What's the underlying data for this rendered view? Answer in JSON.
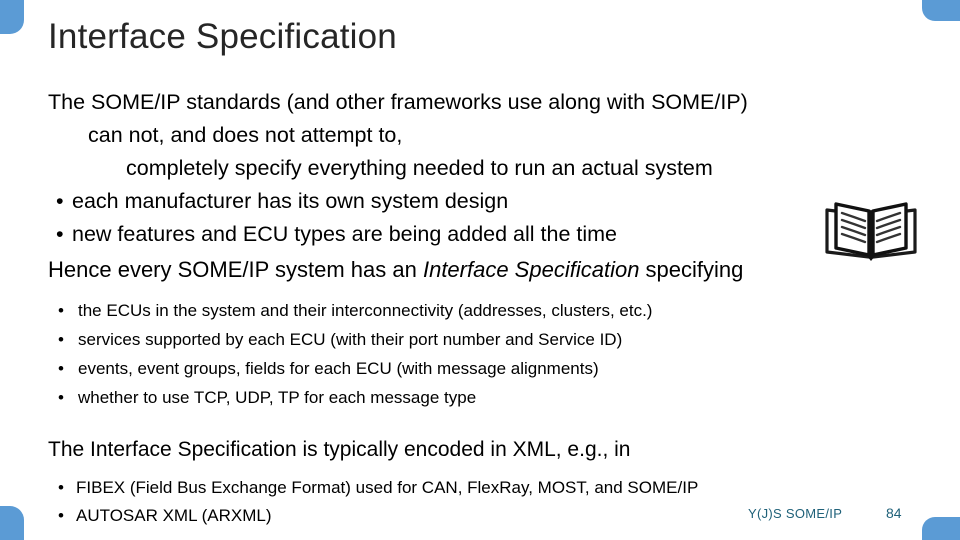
{
  "slide": {
    "title": "Interface Specification",
    "accent_color": "#5B9BD5",
    "footer_color": "#1F6179",
    "text_color": "#000000"
  },
  "intro": {
    "line1": "The SOME/IP standards (and other frameworks use along with SOME/IP)",
    "line2": "can not, and does not attempt to,",
    "line3": "completely specify everything needed to run an actual system"
  },
  "top_bullets": {
    "marker": "•",
    "items": [
      "each manufacturer has its own system design",
      "new features and ECU types are being added all the time"
    ]
  },
  "hence": {
    "before": "Hence every SOME/IP system has an ",
    "italic": "Interface Specification",
    "after": " specifying"
  },
  "spec_bullets": {
    "marker": "•",
    "items": [
      "the ECUs in the system and their interconnectivity (addresses, clusters, etc.)",
      "services supported by each ECU (with their port number and Service ID)",
      "events, event groups, fields for each ECU (with message alignments)",
      "whether to use TCP, UDP, TP for each message type"
    ]
  },
  "closing": {
    "text": "The Interface Specification is typically encoded in XML, e.g., in"
  },
  "format_bullets": {
    "marker": "•",
    "items": [
      "FIBEX (Field Bus Exchange Format) used for CAN, FlexRay, MOST, and SOME/IP",
      "AUTOSAR XML (ARXML)"
    ]
  },
  "footer": {
    "label": "Y(J)S  SOME/IP",
    "page": "84"
  },
  "icons": {
    "book": "open-book-icon"
  }
}
